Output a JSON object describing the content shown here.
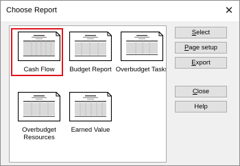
{
  "window": {
    "title": "Choose Report",
    "close_glyph": "✕"
  },
  "reports": [
    {
      "label": "Cash Flow",
      "selected": true
    },
    {
      "label": "Budget Report",
      "selected": false
    },
    {
      "label": "Overbudget Tasks",
      "selected": false
    },
    {
      "label": "Overbudget Resources",
      "selected": false
    },
    {
      "label": "Earned Value",
      "selected": false
    }
  ],
  "buttons": {
    "select": {
      "accel": "S",
      "rest": "elect"
    },
    "page_setup": {
      "accel": "P",
      "rest": "age setup"
    },
    "export": {
      "accel": "E",
      "rest": "xport"
    },
    "close": {
      "accel": "C",
      "rest": "lose"
    },
    "help": {
      "label": "Help"
    }
  },
  "colors": {
    "selection_border": "#e0141e",
    "dialog_bg": "#f0f0f0",
    "button_bg": "#e1e1e1"
  }
}
